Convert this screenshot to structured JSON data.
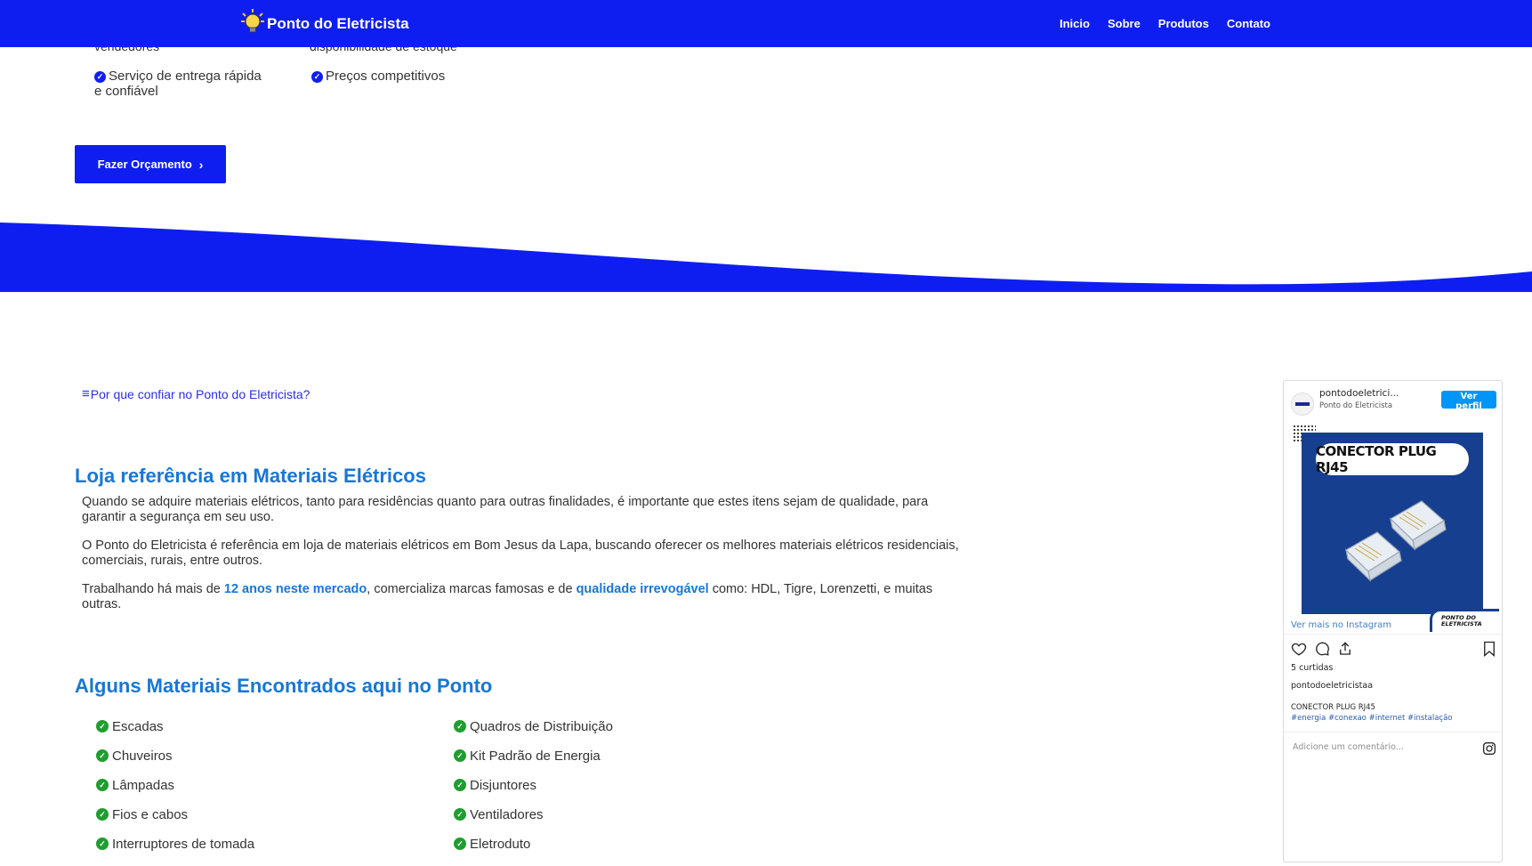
{
  "header": {
    "brand": "Ponto do Eletricista",
    "nav": [
      "Inicio",
      "Sobre",
      "Produtos",
      "Contato"
    ]
  },
  "top": {
    "cut_left": "vendedores",
    "cut_right": "disponibilidade de estoque",
    "features": [
      "Serviço de entrega rápida e confiável",
      "Preços competitivos"
    ],
    "cta_label": "Fazer Orçamento"
  },
  "toc_link": "Por que confiar no Ponto do Eletricista?",
  "loja": {
    "title": "Loja referência em Materiais Elétricos",
    "p1": "Quando se adquire materiais elétricos, tanto para residências quanto para outras finalidades, é importante que estes itens sejam de qualidade, para garantir a segurança em seu uso.",
    "p2": "O Ponto do Eletricista é referência em loja de materiais elétricos em Bom Jesus da Lapa, buscando oferecer os melhores materiais elétricos residenciais, comerciais, rurais, entre outros.",
    "p3_a": "Trabalhando há mais de ",
    "p3_hl1": "12 anos neste mercado",
    "p3_b": ", comercializa marcas famosas e de ",
    "p3_hl2": "qualidade irrevogável",
    "p3_c": " como: HDL, Tigre, Lorenzetti, e muitas outras."
  },
  "materiais": {
    "title": "Alguns Materiais Encontrados aqui no Ponto",
    "col1": [
      "Escadas",
      "Chuveiros",
      "Lâmpadas",
      "Fios e cabos",
      "Interruptores de tomada"
    ],
    "col2": [
      "Quadros de Distribuição",
      "Kit Padrão de Energia",
      "Disjuntores",
      "Ventiladores",
      "Eletroduto"
    ]
  },
  "instagram": {
    "username": "pontodoeletrici...",
    "display_name": "Ponto do Eletricista",
    "follow_label": "Ver perfil",
    "post_title": "CONECTOR PLUG RJ45",
    "post_logo_line1": "PONTO DO",
    "post_logo_line2": "ELETRICISTA",
    "more_label": "Ver mais no Instagram",
    "likes": "5 curtidas",
    "owner": "pontodoeletricistaa",
    "caption": "CONECTOR PLUG RJ45",
    "hashtags": "#energia #conexao #internet #instalação",
    "comment_placeholder": "Adicione um comentário..."
  },
  "colors": {
    "brand_blue": "#0f1ef0",
    "heading_blue": "#1877d6",
    "check_green": "#1e9e2e",
    "post_bg": "#173f8f"
  }
}
